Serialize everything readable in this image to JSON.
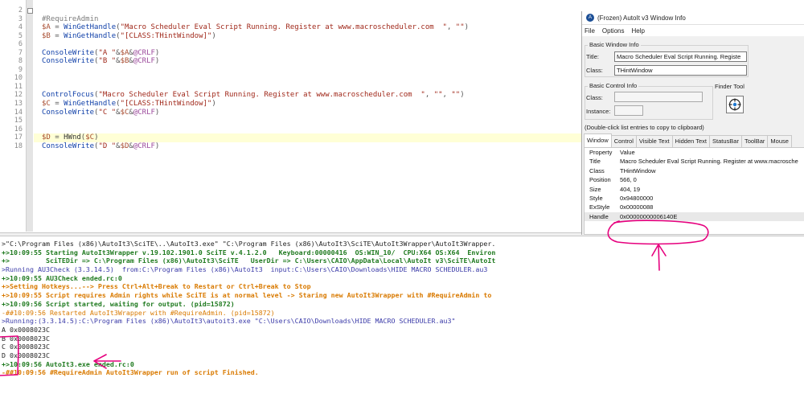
{
  "editor": {
    "line_numbers": [
      "2",
      "3",
      "4",
      "5",
      "6",
      "7",
      "8",
      "9",
      "10",
      "11",
      "12",
      "13",
      "14",
      "15",
      "16",
      "17",
      "18"
    ],
    "lines": [
      [],
      [
        {
          "t": "#RequireAdmin",
          "c": "dir"
        }
      ],
      [
        {
          "t": "$A",
          "c": "var"
        },
        {
          "t": " = ",
          "c": "op"
        },
        {
          "t": "WinGetHandle",
          "c": "fn"
        },
        {
          "t": "(",
          "c": "op"
        },
        {
          "t": "\"Macro Scheduler Eval Script Running. Register at www.macroscheduler.com  \"",
          "c": "str"
        },
        {
          "t": ", ",
          "c": "op"
        },
        {
          "t": "\"\"",
          "c": "str"
        },
        {
          "t": ")",
          "c": "op"
        }
      ],
      [
        {
          "t": "$B",
          "c": "var"
        },
        {
          "t": " = ",
          "c": "op"
        },
        {
          "t": "WinGetHandle",
          "c": "fn"
        },
        {
          "t": "(",
          "c": "op"
        },
        {
          "t": "\"[CLASS:THintWindow]\"",
          "c": "str"
        },
        {
          "t": ")",
          "c": "op"
        }
      ],
      [],
      [
        {
          "t": "ConsoleWrite",
          "c": "fn"
        },
        {
          "t": "(",
          "c": "op"
        },
        {
          "t": "\"A \"",
          "c": "str"
        },
        {
          "t": "&",
          "c": "op"
        },
        {
          "t": "$A",
          "c": "var"
        },
        {
          "t": "&",
          "c": "op"
        },
        {
          "t": "@CRLF",
          "c": "mac"
        },
        {
          "t": ")",
          "c": "op"
        }
      ],
      [
        {
          "t": "ConsoleWrite",
          "c": "fn"
        },
        {
          "t": "(",
          "c": "op"
        },
        {
          "t": "\"B \"",
          "c": "str"
        },
        {
          "t": "&",
          "c": "op"
        },
        {
          "t": "$B",
          "c": "var"
        },
        {
          "t": "&",
          "c": "op"
        },
        {
          "t": "@CRLF",
          "c": "mac"
        },
        {
          "t": ")",
          "c": "op"
        }
      ],
      [],
      [],
      [],
      [
        {
          "t": "ControlFocus",
          "c": "fn"
        },
        {
          "t": "(",
          "c": "op"
        },
        {
          "t": "\"Macro Scheduler Eval Script Running. Register at www.macroscheduler.com  \"",
          "c": "str"
        },
        {
          "t": ", ",
          "c": "op"
        },
        {
          "t": "\"\"",
          "c": "str"
        },
        {
          "t": ", ",
          "c": "op"
        },
        {
          "t": "\"\"",
          "c": "str"
        },
        {
          "t": ")",
          "c": "op"
        }
      ],
      [
        {
          "t": "$C",
          "c": "var"
        },
        {
          "t": " = ",
          "c": "op"
        },
        {
          "t": "WinGetHandle",
          "c": "fn"
        },
        {
          "t": "(",
          "c": "op"
        },
        {
          "t": "\"[CLASS:THintWindow]\"",
          "c": "str"
        },
        {
          "t": ")",
          "c": "op"
        }
      ],
      [
        {
          "t": "ConsoleWrite",
          "c": "fn"
        },
        {
          "t": "(",
          "c": "op"
        },
        {
          "t": "\"C \"",
          "c": "str"
        },
        {
          "t": "&",
          "c": "op"
        },
        {
          "t": "$C",
          "c": "var"
        },
        {
          "t": "&",
          "c": "op"
        },
        {
          "t": "@CRLF",
          "c": "mac"
        },
        {
          "t": ")",
          "c": "op"
        }
      ],
      [],
      [],
      [
        {
          "t": "$D",
          "c": "var"
        },
        {
          "t": " = ",
          "c": "op"
        },
        {
          "t": "HWnd",
          "c": "id"
        },
        {
          "t": "(",
          "c": "op"
        },
        {
          "t": "$C",
          "c": "var"
        },
        {
          "t": ")",
          "c": "op"
        }
      ],
      [
        {
          "t": "ConsoleWrite",
          "c": "fn"
        },
        {
          "t": "(",
          "c": "op"
        },
        {
          "t": "\"D \"",
          "c": "str"
        },
        {
          "t": "&",
          "c": "op"
        },
        {
          "t": "$D",
          "c": "var"
        },
        {
          "t": "&",
          "c": "op"
        },
        {
          "t": "@CRLF",
          "c": "mac"
        },
        {
          "t": ")",
          "c": "op"
        }
      ]
    ],
    "current_line_index": 15
  },
  "output": {
    "lines": [
      {
        "text": ">\"C:\\Program Files (x86)\\AutoIt3\\SciTE\\..\\AutoIt3.exe\" \"C:\\Program Files (x86)\\AutoIt3\\SciTE\\AutoIt3Wrapper\\AutoIt3Wrapper.",
        "style": "dark"
      },
      {
        "text": "+>10:09:55 Starting AutoIt3Wrapper v.19.102.1901.0 SciTE v.4.1.2.0   Keyboard:00000416  OS:WIN_10/  CPU:X64 OS:X64  Environ",
        "style": "green"
      },
      {
        "text": "+>         SciTEDir => C:\\Program Files (x86)\\AutoIt3\\SciTE   UserDir => C:\\Users\\CAIO\\AppData\\Local\\AutoIt v3\\SciTE\\AutoIt",
        "style": "green"
      },
      {
        "text": ">Running AU3Check (3.3.14.5)  from:C:\\Program Files (x86)\\AutoIt3  input:C:\\Users\\CAIO\\Downloads\\HIDE MACRO SCHEDULER.au3",
        "style": "blue"
      },
      {
        "text": "+>10:09:55 AU3Check ended.rc:0",
        "style": "green"
      },
      {
        "text": "+>Setting Hotkeys...--> Press Ctrl+Alt+Break to Restart or Ctrl+Break to Stop",
        "style": "orange"
      },
      {
        "text": "+>10:09:55 Script requires Admin rights while SciTE is at normal level -> Staring new AutoIt3Wrapper with #RequireAdmin to",
        "style": "orange"
      },
      {
        "text": "+>10:09:56 Script started, waiting for output. (pid=15872)",
        "style": "green"
      },
      {
        "text": "-##10:09:56 Restarted AutoIt3Wrapper with #RequireAdmin. (pid=15872)",
        "style": "ored"
      },
      {
        "text": ">Running:(3.3.14.5):C:\\Program Files (x86)\\AutoIt3\\autoit3.exe \"C:\\Users\\CAIO\\Downloads\\HIDE MACRO SCHEDULER.au3\"",
        "style": "blue"
      },
      {
        "text": "A 0x0008023C",
        "style": "dark"
      },
      {
        "text": "B 0x0008023C",
        "style": "dark"
      },
      {
        "text": "C 0x0008023C",
        "style": "dark"
      },
      {
        "text": "D 0x0008023C",
        "style": "dark"
      },
      {
        "text": "+>10:09:56 AutoIt3.exe ended.rc:0",
        "style": "green"
      },
      {
        "text": "-##10:09:56 #RequireAdmin AutoIt3Wrapper run of script Finished.",
        "style": "orange"
      }
    ]
  },
  "window_info": {
    "title": "(Frozen) AutoIt v3 Window Info",
    "menu": [
      "File",
      "Options",
      "Help"
    ],
    "basic_window_info": {
      "group_title": "Basic Window Info",
      "title_label": "Title:",
      "title_value": "Macro Scheduler Eval Script Running. Registe",
      "class_label": "Class:",
      "class_value": "THintWindow"
    },
    "basic_control_info": {
      "group_title": "Basic Control Info",
      "class_label": "Class:",
      "class_value": "",
      "instance_label": "Instance:",
      "instance_value": ""
    },
    "finder_tool": {
      "label": "Finder Tool",
      "icon": "crosshair-icon"
    },
    "hint": "(Double-click list entries to copy to clipboard)",
    "tabs": [
      "Window",
      "Control",
      "Visible Text",
      "Hidden Text",
      "StatusBar",
      "ToolBar",
      "Mouse"
    ],
    "active_tab": 0,
    "list_header": {
      "property": "Property",
      "value": "Value"
    },
    "rows": [
      {
        "property": "Title",
        "value": "Macro Scheduler Eval Script Running. Register at www.macrosche"
      },
      {
        "property": "Class",
        "value": "THintWindow"
      },
      {
        "property": "Position",
        "value": "566, 0"
      },
      {
        "property": "Size",
        "value": "404, 19"
      },
      {
        "property": "Style",
        "value": "0x94800000"
      },
      {
        "property": "ExStyle",
        "value": "0x00000088"
      },
      {
        "property": "Handle",
        "value": "0x00000000006140E"
      }
    ],
    "selected_row": 6
  },
  "colors": {
    "annotation": "#e6007e",
    "editor_highlight": "#ffffd6",
    "output_green": "#1f7a1f",
    "output_orange": "#d97a00",
    "output_blue": "#3a3aa8"
  }
}
